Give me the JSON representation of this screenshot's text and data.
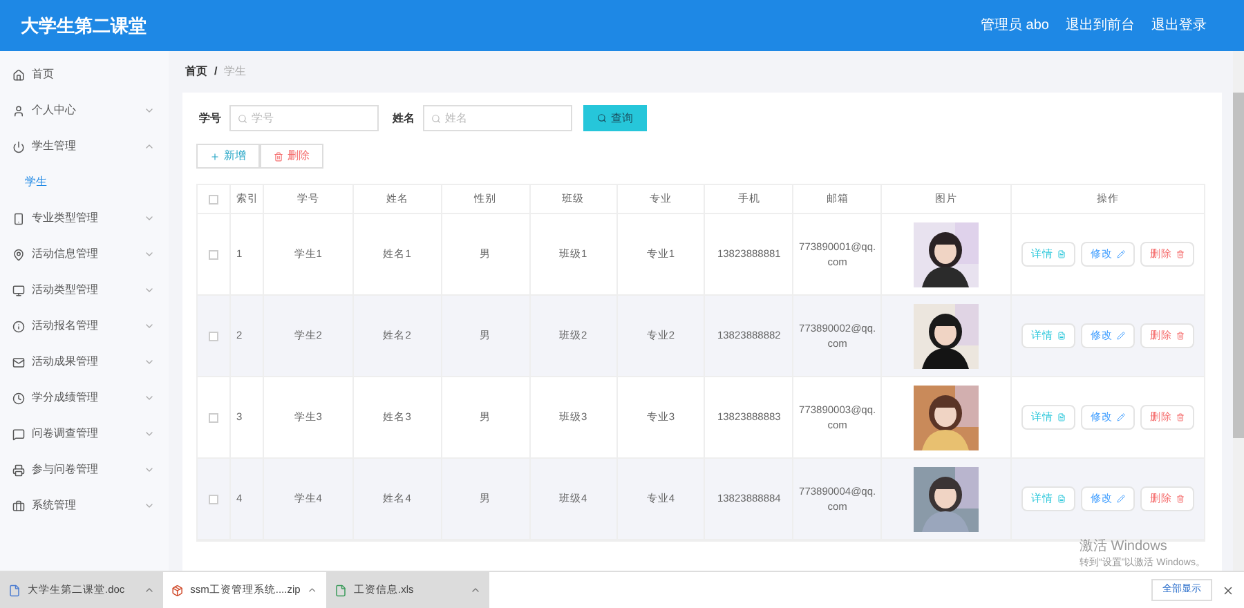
{
  "header": {
    "title": "大学生第二课堂",
    "links": [
      "管理员 abo",
      "退出到前台",
      "退出登录"
    ]
  },
  "sidebar": {
    "items": [
      {
        "label": "首页",
        "has_arrow": false
      },
      {
        "label": "个人中心",
        "expanded": false,
        "has_arrow": true
      },
      {
        "label": "学生管理",
        "expanded": true,
        "has_arrow": true,
        "children": [
          {
            "label": "学生",
            "selected": true
          }
        ]
      },
      {
        "label": "专业类型管理",
        "expanded": false,
        "has_arrow": true
      },
      {
        "label": "活动信息管理",
        "expanded": false,
        "has_arrow": true
      },
      {
        "label": "活动类型管理",
        "expanded": false,
        "has_arrow": true
      },
      {
        "label": "活动报名管理",
        "expanded": false,
        "has_arrow": true
      },
      {
        "label": "活动成果管理",
        "expanded": false,
        "has_arrow": true
      },
      {
        "label": "学分成绩管理",
        "expanded": false,
        "has_arrow": true
      },
      {
        "label": "问卷调查管理",
        "expanded": false,
        "has_arrow": true
      },
      {
        "label": "参与问卷管理",
        "expanded": false,
        "has_arrow": true
      },
      {
        "label": "系统管理",
        "expanded": false,
        "has_arrow": true
      }
    ]
  },
  "breadcrumb": {
    "items": [
      "首页",
      "学生"
    ],
    "separator": "/"
  },
  "search": {
    "fields": [
      {
        "label": "学号",
        "placeholder": "学号"
      },
      {
        "label": "姓名",
        "placeholder": "姓名"
      }
    ],
    "button": "查询"
  },
  "toolbar": {
    "add": "新增",
    "delete": "删除"
  },
  "table": {
    "all_checked": false,
    "columns": [
      "索引",
      "学号",
      "姓名",
      "性别",
      "班级",
      "专业",
      "手机",
      "邮箱",
      "图片",
      "操作"
    ],
    "rows": [
      {
        "checked": false,
        "cells": [
          "1",
          "学生1",
          "姓名1",
          "男",
          "班级1",
          "专业1",
          "13823888881",
          "773890001@qq.com"
        ],
        "photo": {
          "kind": "picture"
        },
        "actions": [
          "详情",
          "修改",
          "删除"
        ]
      },
      {
        "checked": false,
        "cells": [
          "2",
          "学生2",
          "姓名2",
          "男",
          "班级2",
          "专业2",
          "13823888882",
          "773890002@qq.com"
        ],
        "photo": {
          "kind": "picture"
        },
        "actions": [
          "详情",
          "修改",
          "删除"
        ]
      },
      {
        "checked": false,
        "cells": [
          "3",
          "学生3",
          "姓名3",
          "男",
          "班级3",
          "专业3",
          "13823888883",
          "773890003@qq.com"
        ],
        "photo": {
          "kind": "picture"
        },
        "actions": [
          "详情",
          "修改",
          "删除"
        ]
      },
      {
        "checked": false,
        "cells": [
          "4",
          "学生4",
          "姓名4",
          "男",
          "班级4",
          "专业4",
          "13823888884",
          "773890004@qq.com"
        ],
        "photo": {
          "kind": "picture"
        },
        "actions": [
          "详情",
          "修改",
          "删除"
        ]
      }
    ]
  },
  "activation": {
    "title": "激活 Windows",
    "message": "转到“设置”以激活 Windows。"
  },
  "downloads": {
    "files": [
      {
        "name": "大学生第二课堂.doc",
        "kind": "doc"
      },
      {
        "name": "ssm工资管理系统....zip",
        "kind": "zip"
      },
      {
        "name": "工资信息.xls",
        "kind": "xls"
      }
    ],
    "show_all": "全部显示"
  }
}
